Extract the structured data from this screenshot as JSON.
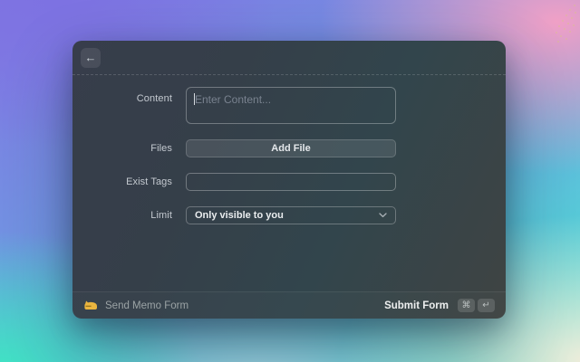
{
  "window": {
    "header": {
      "back_icon": "←"
    },
    "form": {
      "fields": [
        {
          "label": "Content",
          "type": "textarea",
          "placeholder": "Enter Content...",
          "value": ""
        },
        {
          "label": "Files",
          "type": "button",
          "button_label": "Add File"
        },
        {
          "label": "Exist Tags",
          "type": "text-input",
          "value": ""
        },
        {
          "label": "Limit",
          "type": "dropdown",
          "value": "Only visible to you"
        }
      ]
    },
    "footer": {
      "app_icon": "yellow-memo-cat-icon",
      "app_title": "Send Memo Form",
      "primary_action": "Submit Form",
      "shortcut": {
        "modifier": "⌘",
        "key": "↵"
      }
    }
  },
  "colors": {
    "app_icon_yellow": "#eab53f",
    "window_bg_top_left": "#373d4b",
    "window_bg_bottom_left": "#32454c",
    "window_bg_bottom_right": "#3f4443",
    "wallpaper_top_left": "#7d72e2",
    "wallpaper_top_right": "#f0a0c6",
    "wallpaper_bottom_left": "#3fe3c3",
    "wallpaper_bottom_right": "#f3eddb"
  }
}
